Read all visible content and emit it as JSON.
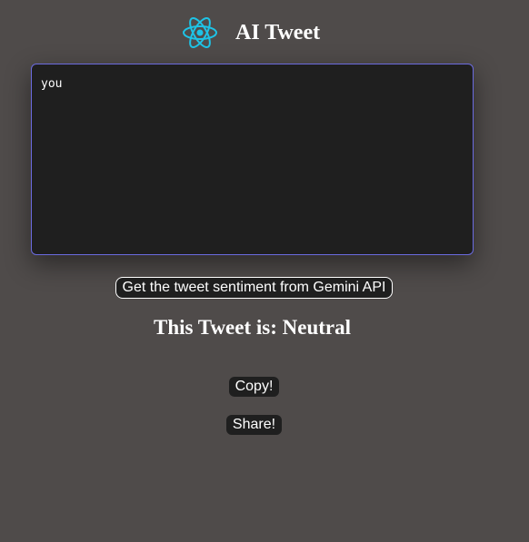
{
  "header": {
    "logo_icon": "react-atom-icon",
    "title": "AI Tweet",
    "accent_color": "#1ec3e6"
  },
  "tweet_input": {
    "value": "you",
    "border_color": "#6b6be0"
  },
  "actions": {
    "sentiment_button_label": "Get the tweet sentiment from Gemini API",
    "copy_button_label": "Copy!",
    "share_button_label": "Share!"
  },
  "result": {
    "text": "This Tweet is: Neutral"
  }
}
